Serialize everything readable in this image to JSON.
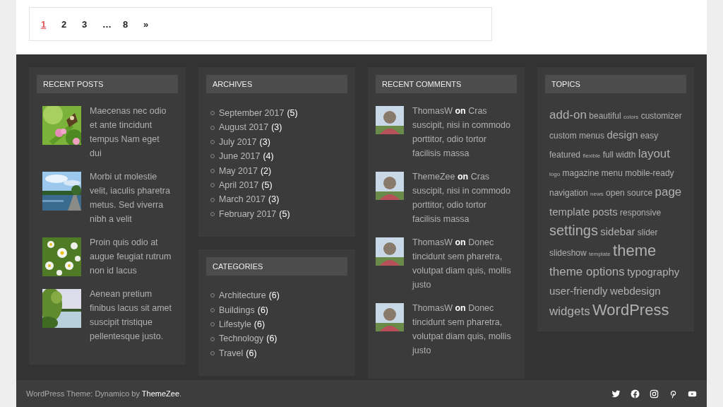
{
  "pagination": [
    {
      "label": "1",
      "selected": true
    },
    {
      "label": "2",
      "selected": false
    },
    {
      "label": "3",
      "selected": false
    },
    {
      "label": "…",
      "selected": false
    },
    {
      "label": "8",
      "selected": false
    },
    {
      "label": "»",
      "selected": false
    }
  ],
  "recent_posts": {
    "title": "RECENT POSTS",
    "posts": [
      {
        "title": "Maecenas nec odio et ante tincidunt tempus Nam eget dui"
      },
      {
        "title": "Morbi ut molestie velit, iaculis pharetra metus. Sed viverra nibh a velit"
      },
      {
        "title": "Proin quis odio at augue feugiat rutrum non id lacus"
      },
      {
        "title": "Aenean pretium finibus lacus sit amet suscipit tristique pellentesque justo."
      }
    ]
  },
  "archives": {
    "title": "ARCHIVES",
    "items": [
      {
        "label": "September 2017",
        "count": "(5)"
      },
      {
        "label": "August 2017",
        "count": "(3)"
      },
      {
        "label": "July 2017",
        "count": "(3)"
      },
      {
        "label": "June 2017",
        "count": "(4)"
      },
      {
        "label": "May 2017",
        "count": "(2)"
      },
      {
        "label": "April 2017",
        "count": "(5)"
      },
      {
        "label": "March 2017",
        "count": "(3)"
      },
      {
        "label": "February 2017",
        "count": "(5)"
      }
    ]
  },
  "categories": {
    "title": "CATEGORIES",
    "items": [
      {
        "label": "Architecture",
        "count": "(6)"
      },
      {
        "label": "Buildings",
        "count": "(6)"
      },
      {
        "label": "Lifestyle",
        "count": "(6)"
      },
      {
        "label": "Technology",
        "count": "(6)"
      },
      {
        "label": "Travel",
        "count": "(6)"
      }
    ]
  },
  "recent_comments": {
    "title": "RECENT COMMENTS",
    "comments": [
      {
        "author": "ThomasW",
        "connector": "on",
        "post": "Cras suscipit, nisi in commodo porttitor, odio tortor facilisis massa"
      },
      {
        "author": "ThemeZee",
        "connector": "on",
        "post": "Cras suscipit, nisi in commodo porttitor, odio tortor facilisis massa"
      },
      {
        "author": "ThomasW",
        "connector": "on",
        "post": "Donec tincidunt sem pharetra, volutpat diam quis, mollis justo"
      },
      {
        "author": "ThomasW",
        "connector": "on",
        "post": "Donec tincidunt sem pharetra, volutpat diam quis, mollis justo"
      }
    ]
  },
  "topics": {
    "title": "TOPICS",
    "tags": [
      {
        "label": "add-on",
        "kind": "large"
      },
      {
        "label": "beautiful",
        "kind": "small"
      },
      {
        "label": "colors",
        "kind": "tiny"
      },
      {
        "label": "customizer",
        "kind": "small"
      },
      {
        "label": "custom menus",
        "kind": "small"
      },
      {
        "label": "design",
        "kind": "medium"
      },
      {
        "label": "easy",
        "kind": "small"
      },
      {
        "label": "featured",
        "kind": "small"
      },
      {
        "label": "flexible",
        "kind": "tiny"
      },
      {
        "label": "full width",
        "kind": "small"
      },
      {
        "label": "layout",
        "kind": "large"
      },
      {
        "label": "logo",
        "kind": "tiny"
      },
      {
        "label": "magazine",
        "kind": "small"
      },
      {
        "label": "menu",
        "kind": "small"
      },
      {
        "label": "mobile-ready",
        "kind": "small"
      },
      {
        "label": "navigation",
        "kind": "small"
      },
      {
        "label": "news",
        "kind": "tiny"
      },
      {
        "label": "open source",
        "kind": "small"
      },
      {
        "label": "page",
        "kind": "large"
      },
      {
        "label": "template",
        "kind": "medium"
      },
      {
        "label": "posts",
        "kind": "medium"
      },
      {
        "label": "responsive",
        "kind": "small"
      },
      {
        "label": "settings",
        "kind": "xlarge"
      },
      {
        "label": "sidebar",
        "kind": "medium"
      },
      {
        "label": "slider",
        "kind": "small"
      },
      {
        "label": "slideshow",
        "kind": "small"
      },
      {
        "label": "template",
        "kind": "tiny"
      },
      {
        "label": "theme",
        "kind": "huge"
      },
      {
        "label": "theme options",
        "kind": "large"
      },
      {
        "label": "typography",
        "kind": "medium"
      },
      {
        "label": "user-friendly",
        "kind": "medium"
      },
      {
        "label": "webdesign",
        "kind": "medium"
      },
      {
        "label": "widgets",
        "kind": "large"
      },
      {
        "label": "WordPress",
        "kind": "huge"
      }
    ]
  },
  "footer": {
    "text": "WordPress Theme: Dynamico by",
    "link": "ThemeZee",
    "end": "."
  }
}
